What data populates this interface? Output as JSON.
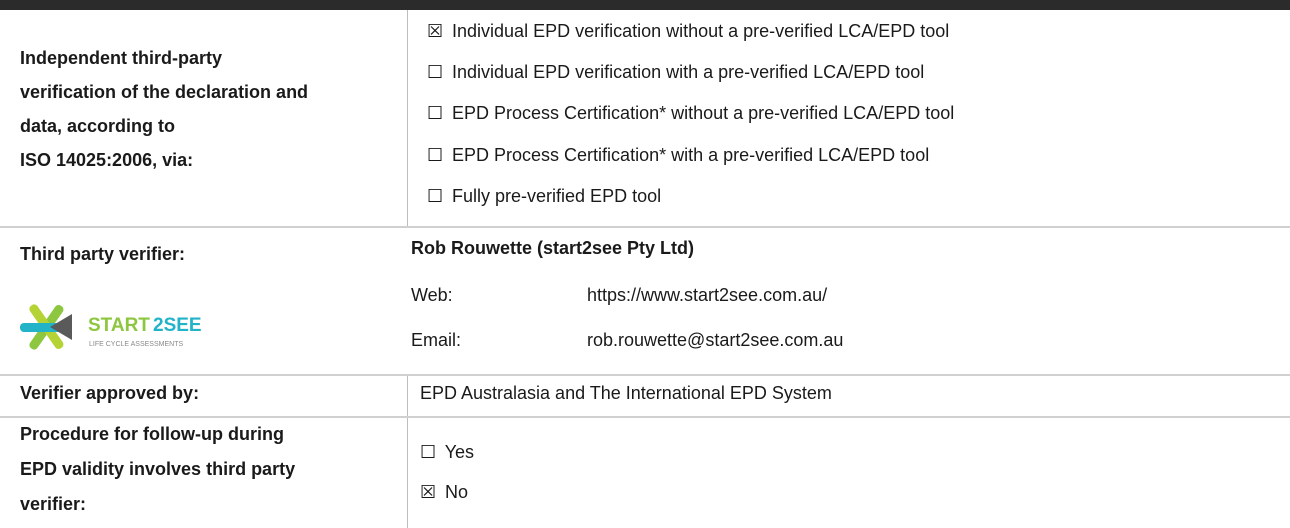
{
  "verification": {
    "label_lines": [
      "Independent third-party",
      "verification of the declaration and",
      "data, according to",
      "ISO 14025:2006, via:"
    ],
    "options": [
      {
        "mark": "☒",
        "text": "Individual EPD verification without a pre-verified LCA/EPD tool"
      },
      {
        "mark": "☐",
        "text": "Individual EPD verification with a pre-verified LCA/EPD tool"
      },
      {
        "mark": "☐",
        "text": "EPD Process Certification* without a pre-verified LCA/EPD tool"
      },
      {
        "mark": "☐",
        "text": "EPD Process Certification* with a pre-verified LCA/EPD tool"
      },
      {
        "mark": "☐",
        "text": "Fully pre-verified EPD tool"
      }
    ]
  },
  "verifier": {
    "label": "Third party verifier:",
    "name": "Rob Rouwette (start2see Pty Ltd)",
    "web_label": "Web:",
    "web_value": "https://www.start2see.com.au/",
    "email_label": "Email:",
    "email_value": "rob.rouwette@start2see.com.au",
    "logo_text_start": "START",
    "logo_text_see": "2SEE",
    "logo_tagline": "LIFE CYCLE ASSESSMENTS",
    "colors": {
      "green": "#8dc63f",
      "teal": "#22b3c8",
      "dark": "#4a4a4a"
    }
  },
  "approved": {
    "label": "Verifier approved by:",
    "value": "EPD Australasia and The International EPD System"
  },
  "followup": {
    "label_lines": [
      "Procedure for follow-up during",
      "EPD validity involves third party",
      "verifier:"
    ],
    "options": [
      {
        "mark": "☐",
        "text": "Yes"
      },
      {
        "mark": "☒",
        "text": "No"
      }
    ]
  }
}
